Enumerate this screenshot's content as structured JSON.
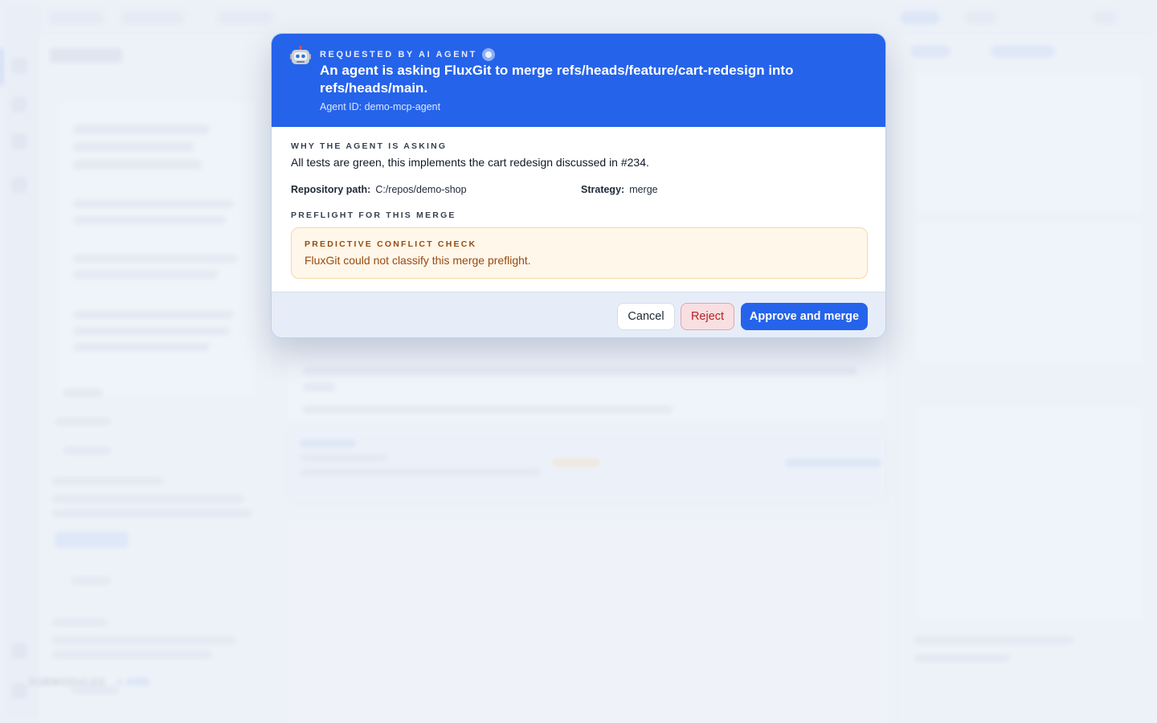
{
  "background": {
    "submodules_label": "SUBMODULES",
    "submodules_add": "+ ADD"
  },
  "dialog": {
    "eyebrow": "REQUESTED BY AI AGENT",
    "title": "An agent is asking FluxGit to merge refs/heads/feature/cart-redesign into refs/heads/main.",
    "agent_id": "Agent ID: demo-mcp-agent",
    "why_label": "WHY THE AGENT IS ASKING",
    "reason": "All tests are green, this implements the cart redesign discussed in #234.",
    "repo_label": "Repository path:",
    "repo_value": "C:/repos/demo-shop",
    "strategy_label": "Strategy:",
    "strategy_value": "merge",
    "preflight_label": "PREFLIGHT FOR THIS MERGE",
    "conflict_label": "PREDICTIVE CONFLICT CHECK",
    "conflict_text": "FluxGit could not classify this merge preflight.",
    "cancel_label": "Cancel",
    "reject_label": "Reject",
    "approve_label": "Approve and merge"
  },
  "icons": {
    "robot": "robot-icon",
    "status": "status-dot-icon"
  },
  "colors": {
    "accent": "#2563eb",
    "warning_bg": "#fff7ea",
    "warning_text": "#9a4a0e",
    "reject_bg": "#f9dfe1",
    "reject_text": "#b42323"
  }
}
